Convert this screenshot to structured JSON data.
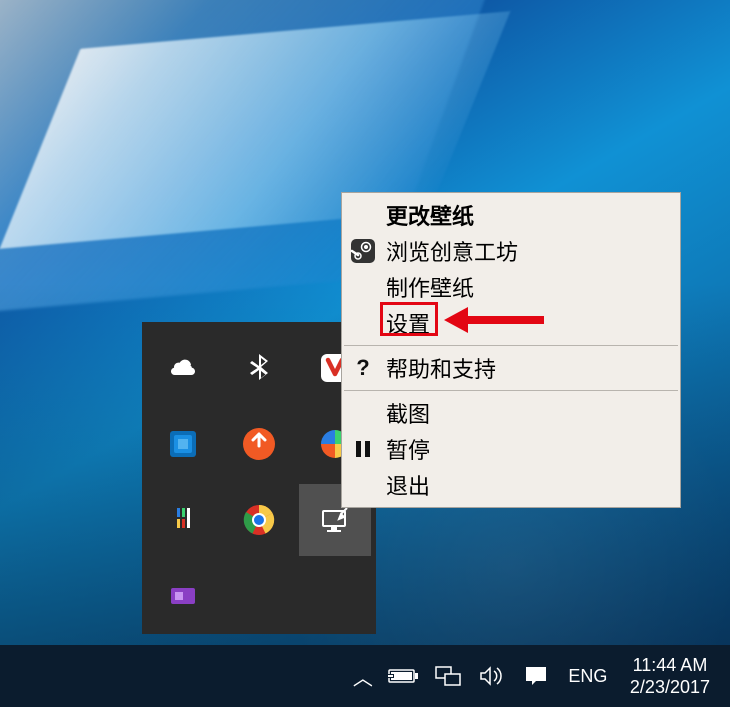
{
  "context_menu": {
    "items": [
      {
        "label": "更改壁纸",
        "bold": true,
        "icon": null
      },
      {
        "label": "浏览创意工坊",
        "icon": "steam-icon"
      },
      {
        "label": "制作壁纸",
        "icon": null
      },
      {
        "label": "设置",
        "icon": null,
        "highlighted": true
      }
    ],
    "group2": [
      {
        "label": "帮助和支持",
        "icon": "question-icon"
      }
    ],
    "group3": [
      {
        "label": "截图",
        "icon": null
      },
      {
        "label": "暂停",
        "icon": "pause-icon"
      },
      {
        "label": "退出",
        "icon": null
      }
    ]
  },
  "tray_overflow": {
    "icons": [
      {
        "name": "onedrive-icon"
      },
      {
        "name": "bluetooth-icon"
      },
      {
        "name": "vivaldi-icon"
      },
      {
        "name": "intel-graphics-icon"
      },
      {
        "name": "update-icon"
      },
      {
        "name": "download-manager-icon"
      },
      {
        "name": "everything-icon"
      },
      {
        "name": "chrome-icon"
      },
      {
        "name": "wallpaper-engine-icon",
        "selected": true
      },
      {
        "name": "purple-app-icon"
      }
    ]
  },
  "taskbar": {
    "chevron": "︿",
    "language": "ENG",
    "time": "11:44 AM",
    "date": "2/23/2017"
  },
  "colors": {
    "highlight_red": "#e30613",
    "menu_bg": "#f2eee9",
    "tray_bg": "#2a2a2a",
    "taskbar_bg": "#0b1c2e"
  }
}
